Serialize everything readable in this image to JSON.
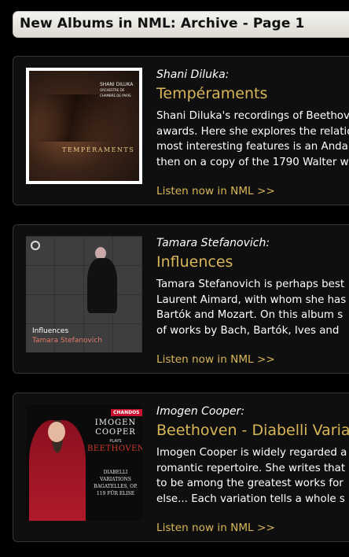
{
  "header": {
    "title": "New Albums in NML: Archive - Page 1"
  },
  "albums": [
    {
      "artist": "Shani Diluka:",
      "title": "Tempéraments",
      "cover_text": {
        "name": "SHANI DILUKA",
        "ensemble": "ORCHESTRE DE CHAMBRE DE PARIS",
        "album": "TEMPÉRAMENTS"
      },
      "desc": [
        "Shani Diluka's recordings of Beethoven",
        "awards. Here she explores the relation",
        "most interesting features is an Andante",
        "then on a copy of the 1790 Walter w"
      ],
      "listen": "Listen now in NML >>"
    },
    {
      "artist": "Tamara Stefanovich:",
      "title": "Influences",
      "cover_text": {
        "title": "Influences",
        "artist": "Tamara Stefanovich"
      },
      "desc": [
        "Tamara Stefanovich is perhaps best",
        "Laurent Aimard, with whom she has",
        "Bartók and Mozart. On this album s",
        "of works by Bach, Bartók, Ives and"
      ],
      "listen": "Listen now in NML >>"
    },
    {
      "artist": "Imogen Cooper:",
      "title": "Beethoven - Diabelli Variat",
      "cover_text": {
        "label": "CHANDOS",
        "name1": "IMOGEN",
        "name2": "COOPER",
        "plays": "PLAYS",
        "composer": "BEETHOVEN",
        "works": "DIABELLI VARIATIONS BAGATELLES, OP. 119 FÜR ELISE"
      },
      "desc": [
        "Imogen Cooper is widely regarded a",
        "romantic repertoire. She writes that",
        "to be among the greatest works for",
        "else... Each variation tells a whole s"
      ],
      "listen": "Listen now in NML >>"
    }
  ]
}
